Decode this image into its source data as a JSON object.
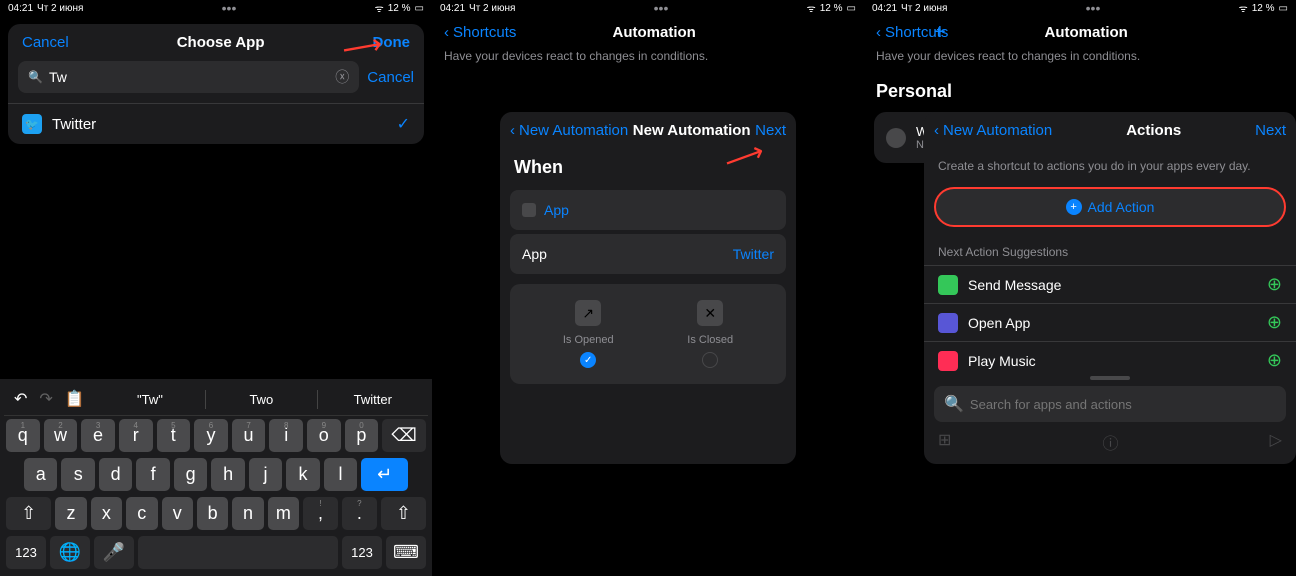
{
  "status": {
    "time": "04:21",
    "date": "Чт 2 июня",
    "battery": "12 %"
  },
  "panel1": {
    "modal": {
      "cancel": "Cancel",
      "title": "Choose App",
      "done": "Done",
      "search_value": "Tw",
      "search_cancel": "Cancel"
    },
    "app": {
      "name": "Twitter"
    },
    "keyboard": {
      "suggest1": "\"Tw\"",
      "suggest2": "Two",
      "suggest3": "Twitter",
      "row1": [
        "q",
        "w",
        "e",
        "r",
        "t",
        "y",
        "u",
        "i",
        "o",
        "p"
      ],
      "row1_nums": [
        "1",
        "2",
        "3",
        "4",
        "5",
        "6",
        "7",
        "8",
        "9",
        "0"
      ],
      "row2": [
        "a",
        "s",
        "d",
        "f",
        "g",
        "h",
        "j",
        "k",
        "l"
      ],
      "row3": [
        "z",
        "x",
        "c",
        "v",
        "b",
        "n",
        "m"
      ],
      "num_key": "123"
    }
  },
  "panel2": {
    "back": "Shortcuts",
    "title": "Automation",
    "subtitle": "Have your devices react to changes in conditions.",
    "modal": {
      "back": "New Automation",
      "title": "New Automation",
      "next": "Next",
      "when": "When",
      "app_label": "App",
      "app_value": "Twitter",
      "opened": "Is Opened",
      "closed": "Is Closed"
    }
  },
  "panel3": {
    "back": "Shortcuts",
    "title": "Automation",
    "subtitle": "Have your devices react to changes in conditions.",
    "personal": "Personal",
    "card": {
      "title": "When \"Tw",
      "sub": "No actions"
    },
    "modal": {
      "back": "New Automation",
      "title": "Actions",
      "next": "Next",
      "help": "Create a shortcut to actions you do in your apps every day.",
      "add_action": "Add Action",
      "suggestions_header": "Next Action Suggestions",
      "actions": [
        {
          "name": "Send Message",
          "color": "#34c759"
        },
        {
          "name": "Open App",
          "color": "#5856d6"
        },
        {
          "name": "Play Music",
          "color": "#ff2d55"
        }
      ],
      "search_placeholder": "Search for apps and actions"
    }
  }
}
